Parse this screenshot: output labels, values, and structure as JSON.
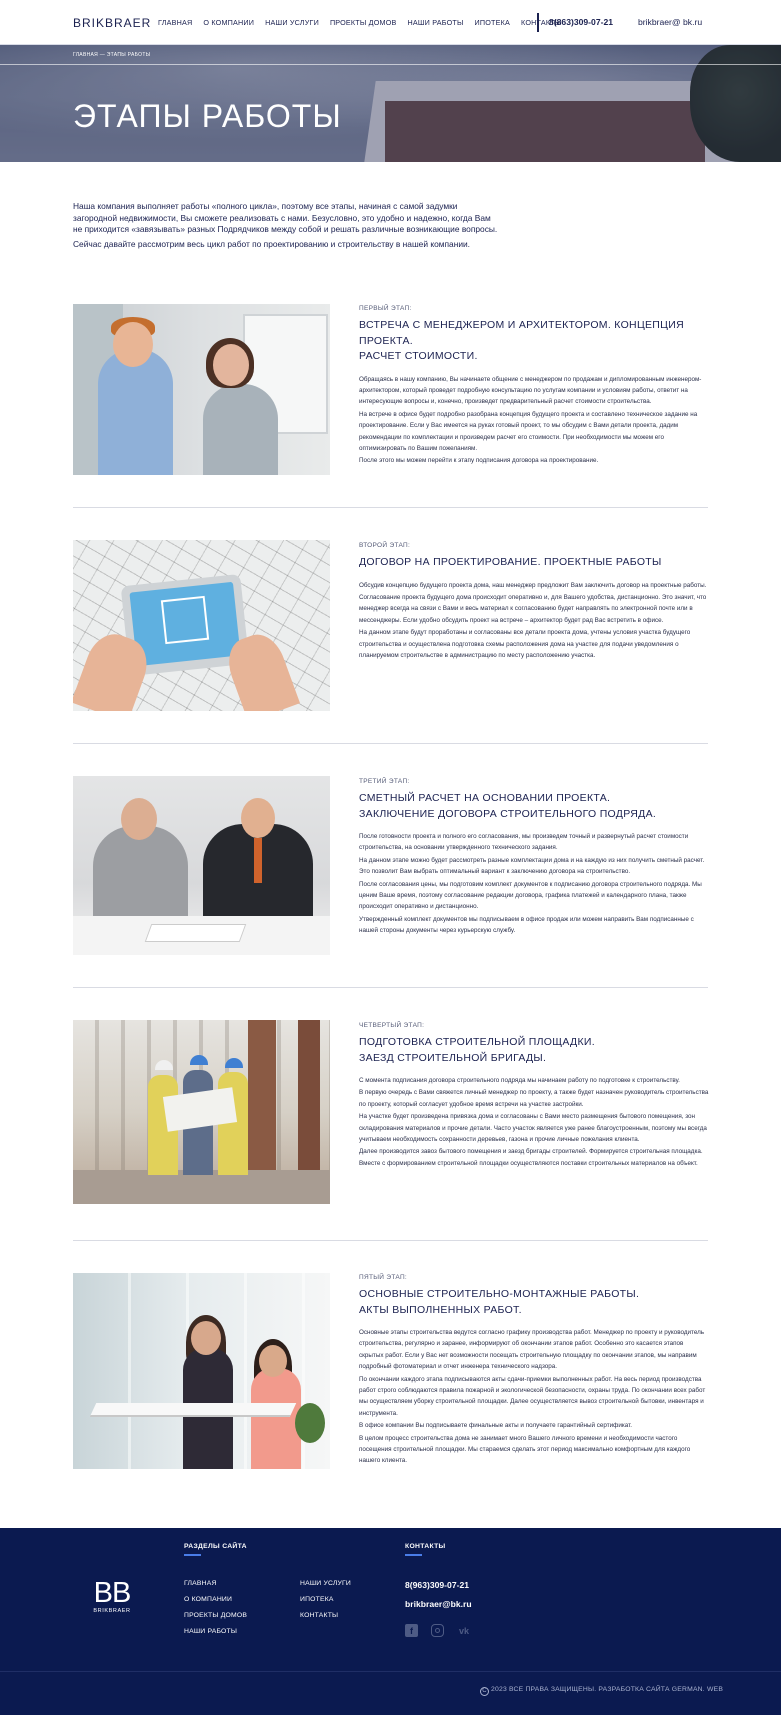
{
  "header": {
    "logo": "BRIKBRAER",
    "nav": [
      "ГЛАВНАЯ",
      "О КОМПАНИИ",
      "НАШИ УСЛУГИ",
      "ПРОЕКТЫ ДОМОВ",
      "НАШИ РАБОТЫ",
      "ИПОТЕКА",
      "КОНТАКТЫ"
    ],
    "phone": "8(863)309-07-21",
    "email": "brikbraer@ bk.ru"
  },
  "hero": {
    "breadcrumb": "ГЛАВНАЯ — ЭТАПЫ РАБОТЫ",
    "title": "ЭТАПЫ РАБОТЫ"
  },
  "intro": {
    "p1": "Наша компания выполняет работы «полного цикла», поэтому все этапы, начиная с самой задумки загородной недвижимости, Вы сможете реализовать с нами. Безусловно, это удобно и надежно, когда Вам не приходится «завязывать» разных Подрядчиков между собой и решать различные возникающие вопросы.",
    "p2": "Сейчас давайте рассмотрим весь цикл работ по проектированию и строительству в нашей компании."
  },
  "stages": [
    {
      "num": "ПЕРВЫЙ ЭТАП:",
      "title1": "ВСТРЕЧА С МЕНЕДЖЕРОМ И АРХИТЕКТОРОМ. КОНЦЕПЦИЯ ПРОЕКТА.",
      "title2": "РАСЧЕТ СТОИМОСТИ.",
      "paragraphs": [
        "Обращаясь в нашу компанию, Вы начинаете общение с менеджером по продажам и дипломированным инженером-архитектором, который проведет подробную консультацию по услугам компании и условиям работы, ответит на интересующие вопросы и, конечно, произведет предварительный расчет стоимости строительства.",
        "На встрече в офисе будет подробно разобрана концепция будущего проекта и составлено техническое задание на проектирование. Если у Вас имеется на руках готовый проект, то мы обсудим с Вами детали проекта, дадим рекомендации по комплектации и произведем расчет его стоимости. При необходимости мы можем его оптимизировать по Вашим пожеланиям.",
        "После этого мы можем перейти   к этапу подписания договора на проектирование."
      ]
    },
    {
      "num": "ВТОРОЙ ЭТАП:",
      "title1": "ДОГОВОР НА ПРОЕКТИРОВАНИЕ. ПРОЕКТНЫЕ РАБОТЫ",
      "title2": "",
      "paragraphs": [
        "Обсудив концепцию будущего проекта дома, наш менеджер предложит Вам заключить договор на проектные работы.",
        "Согласование проекта будущего дома происходит оперативно и, для Вашего удобства, дистанционно. Это значит, что менеджер всегда на связи с Вами и весь материал к согласованию будет направлять по электронной почте или в мессенджеры. Если удобно обсудить проект на встрече – архитектор будет рад Вас встретить в офисе.",
        "На данном этапе будут проработаны и согласованы все детали проекта дома, учтены условия участка будущего строительства и осуществлена подготовка схемы расположения дома на участке для подачи уведомления о планируемом строительстве в администрацию по месту расположению участка."
      ]
    },
    {
      "num": "ТРЕТИЙ ЭТАП:",
      "title1": "СМЕТНЫЙ РАСЧЕТ НА ОСНОВАНИИ ПРОЕКТА.",
      "title2": "ЗАКЛЮЧЕНИЕ ДОГОВОРА СТРОИТЕЛЬНОГО ПОДРЯДА.",
      "paragraphs": [
        "После готовности проекта и полного его согласования, мы произведем точный и развернутый расчет стоимости строительства, на основании утвержденного технического задания.",
        "На данном этапе можно будет рассмотреть разные комплектации дома и на каждую из них получить сметный расчет. Это позволит Вам выбрать оптимальный вариант к заключению договора на строительство.",
        "После согласования цены, мы подготовим комплект документов к подписанию договора строительного подряда. Мы ценим Ваше время, поэтому согласование редакции договора, графика платежей и календарного плана, также происходит оперативно и дистанционно.",
        "Утвержденный комплект документов мы подписываем в офисе продаж или можем направить Вам подписанные с нашей стороны документы через курьерскую службу."
      ]
    },
    {
      "num": "ЧЕТВЕРТЫЙ ЭТАП:",
      "title1": "ПОДГОТОВКА СТРОИТЕЛЬНОЙ ПЛОЩАДКИ.",
      "title2": "ЗАЕЗД СТРОИТЕЛЬНОЙ БРИГАДЫ.",
      "paragraphs": [
        "С момента подписания договора строительного подряда мы начинаем работу по подготовке к строительству.",
        "В первую очередь с Вами свяжется личный менеджер по проекту, а также будет назначен руководитель строительства по проекту, который согласует удобное время встречи на участке застройки.",
        "На участке будет произведена привязка дома и согласованы с Вами место размещения бытового помещения, зон складирования материалов и прочие детали. Часто участок является уже ранее благоустроенным, поэтому мы всегда учитываем необходимость сохранности деревьев, газона и прочие личные пожелания клиента.",
        "Далее производится завоз бытового помещения и заезд бригады строителей. Формируется строительная площадка. Вместе с формированием строительной площадки осуществляются поставки строительных материалов на объект."
      ]
    },
    {
      "num": "ПЯТЫЙ ЭТАП:",
      "title1": "ОСНОВНЫЕ СТРОИТЕЛЬНО-МОНТАЖНЫЕ РАБОТЫ.",
      "title2": "АКТЫ ВЫПОЛНЕННЫХ РАБОТ.",
      "paragraphs": [
        "Основные этапы строительства ведутся согласно графику производства работ. Менеджер по проекту и руководитель строительства, регулярно и заранее, информируют об окончании этапов работ. Особенно это касается этапов скрытых работ. Если у Вас нет возможности посещать строительную площадку по окончании этапов, мы направим подробный фотоматериал и отчет инженера технического надзора.",
        "По окончании каждого этапа подписываются акты сдачи-приемки выполненных работ. На весь период производства работ строго соблюдаются правила пожарной и экологической безопасности, охраны труда. По окончании всех работ мы осуществляем уборку строительной площадки. Далее осуществляется вывоз строительной бытовки, инвентаря и инструмента.",
        "В офисе компании Вы подписываете финальные акты и получаете гарантийный сертификат.",
        "В целом процесс строительства дома не занимает много Вашего личного времени и необходимости частого посещения строительной площадки. Мы стараемся сделать этот период максимально комфортным для каждого нашего клиента."
      ]
    }
  ],
  "footer": {
    "sections_heading": "РАЗДЕЛЫ САЙТА",
    "contacts_heading": "КОНТАКТЫ",
    "logo_mark": "BB",
    "logo_name": "BRIKBRAER",
    "links_col1": [
      "ГЛАВНАЯ",
      "О КОМПАНИИ",
      "ПРОЕКТЫ ДОМОВ",
      "НАШИ РАБОТЫ"
    ],
    "links_col2": [
      "НАШИ УСЛУГИ",
      "ИПОТЕКА",
      "КОНТАКТЫ"
    ],
    "phone": "8(963)309-07-21",
    "email": "brikbraer@bk.ru",
    "social_icons": [
      "facebook-icon",
      "instagram-icon",
      "vk-icon"
    ],
    "copyright_symbol": "C",
    "copyright": "2023 ВСЕ ПРАВА ЗАЩИЩЕНЫ. РАЗРАБОТКА САЙТА GERMAN. WEB"
  }
}
